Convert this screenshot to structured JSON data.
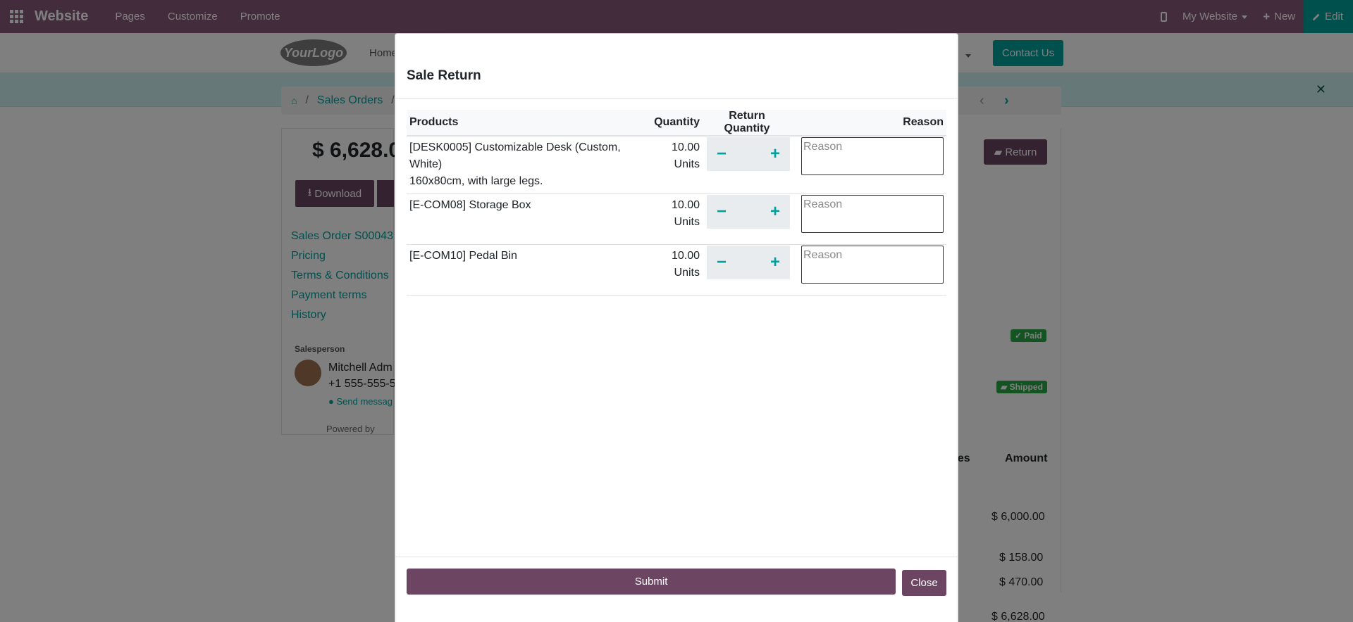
{
  "topbar": {
    "brand": "Website",
    "menu": [
      "Pages",
      "Customize",
      "Promote"
    ],
    "site_selector": "My Website",
    "new_label": "New",
    "edit_label": "Edit",
    "color": "#875a7b",
    "edit_color": "#00a09d"
  },
  "site": {
    "nav_home": "Home",
    "contact_button": "Contact Us",
    "breadcrumb": {
      "sales_orders": "Sales Orders"
    },
    "order_total": "$ 6,628.0",
    "download_label": "Download",
    "side_links": [
      "Sales Order S00043",
      "Pricing",
      "Terms & Conditions",
      "Payment terms",
      "History"
    ],
    "salesperson_label": "Salesperson",
    "salesperson_name": "Mitchell Adm",
    "salesperson_phone": "+1 555-555-5",
    "send_message": "Send messag",
    "powered_by": "Powered by",
    "return_button": "Return",
    "badge_paid": "Paid",
    "badge_shipped": "Shipped",
    "table_taxes": "xes",
    "table_amount": "Amount",
    "amounts": [
      "$ 6,000.00",
      "$ 158.00",
      "$ 470.00",
      "$ 6,628.00"
    ]
  },
  "modal": {
    "title": "Sale Return",
    "columns": {
      "products": "Products",
      "quantity": "Quantity",
      "return_quantity": "Return Quantity",
      "reason": "Reason"
    },
    "rows": [
      {
        "product": "[DESK0005] Customizable Desk (Custom, White)",
        "description": "160x80cm, with large legs.",
        "quantity": "10.00",
        "unit": "Units",
        "reason_placeholder": "Reason"
      },
      {
        "product": "[E-COM08] Storage Box",
        "description": "",
        "quantity": "10.00",
        "unit": "Units",
        "reason_placeholder": "Reason"
      },
      {
        "product": "[E-COM10] Pedal Bin",
        "description": "",
        "quantity": "10.00",
        "unit": "Units",
        "reason_placeholder": "Reason"
      }
    ],
    "stepper": {
      "minus": "−",
      "plus": "+"
    },
    "submit_label": "Submit",
    "close_label": "Close",
    "button_color": "#6b4562"
  }
}
